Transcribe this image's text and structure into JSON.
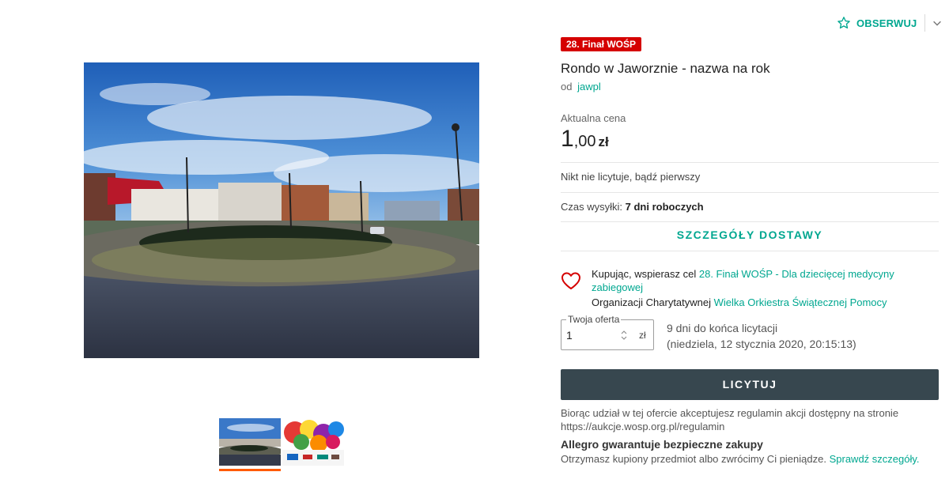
{
  "watch": {
    "label": "OBSERWUJ"
  },
  "offer": {
    "badge": "28. Finał WOŚP",
    "title": "Rondo w Jaworznie - nazwa na rok",
    "seller_prefix": "od",
    "seller_name": "jawpl",
    "price_label": "Aktualna cena",
    "price_int": "1",
    "price_dec": ",00",
    "price_currency": "zł",
    "no_bids": "Nikt nie licytuje, bądź pierwszy",
    "shipping_label": "Czas wysyłki:",
    "shipping_value": "7 dni roboczych",
    "delivery_button": "SZCZEGÓŁY DOSTAWY"
  },
  "charity": {
    "prefix": "Kupując, wspierasz cel",
    "goal_link": "28. Finał WOŚP - Dla dziecięcej medycyny zabiegowej",
    "org_prefix": "Organizacji Charytatywnej",
    "org_link": "Wielka Orkiestra Świątecznej Pomocy"
  },
  "bid": {
    "legend": "Twoja oferta",
    "value": "1",
    "currency": "zł",
    "countdown_line1": "9 dni do końca licytacji",
    "countdown_line2": "(niedziela, 12 stycznia 2020, 20:15:13)",
    "button": "LICYTUJ"
  },
  "terms": "Biorąc udział w tej ofercie akceptujesz regulamin akcji dostępny na stronie https://aukcje.wosp.org.pl/regulamin",
  "guarantee": {
    "title": "Allegro gwarantuje bezpieczne zakupy",
    "text": "Otrzymasz kupiony przedmiot albo zwrócimy Ci pieniądze.",
    "link": "Sprawdź szczegóły."
  },
  "colors": {
    "accent": "#00a790",
    "badge": "#d50000",
    "button": "#37474f",
    "thumb_active": "#ff5a00"
  },
  "icons": {
    "watch": "star-outline-icon",
    "menu": "chevron-down-icon",
    "charity": "heart-outline-icon",
    "stepper": "up-down-arrows-icon"
  }
}
